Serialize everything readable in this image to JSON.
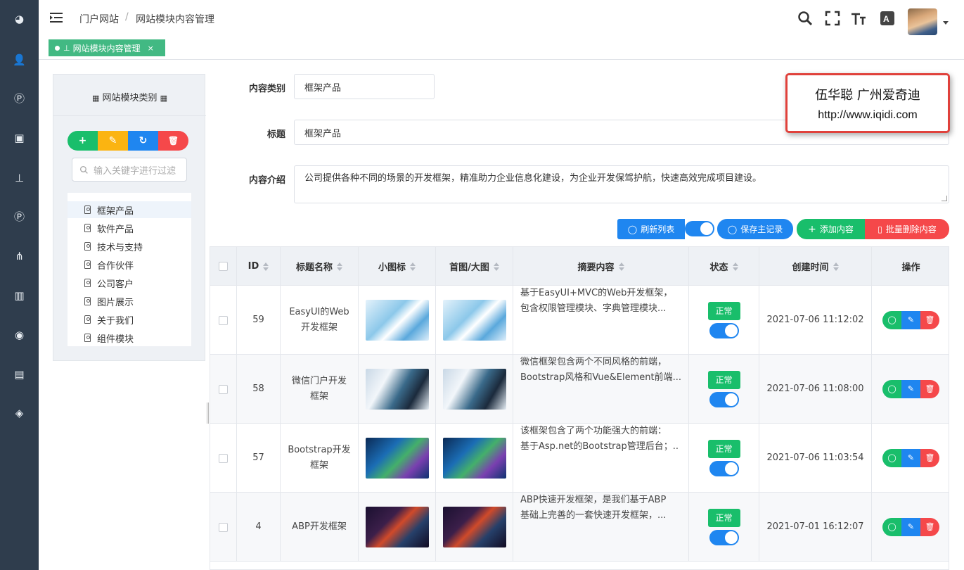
{
  "breadcrumb": {
    "root": "门户网站",
    "current": "网站模块内容管理"
  },
  "tab": {
    "label": "网站模块内容管理",
    "close": "×"
  },
  "tree": {
    "title": "网站模块类别",
    "search_placeholder": "输入关键字进行过滤",
    "items": [
      "框架产品",
      "软件产品",
      "技术与支持",
      "合作伙伴",
      "公司客户",
      "图片展示",
      "关于我们",
      "组件模块"
    ],
    "buttons": {
      "add": "+",
      "edit": "✎",
      "refresh": "↻",
      "delete": "🗑"
    }
  },
  "form": {
    "category_label": "内容类别",
    "category_value": "框架产品",
    "title_label": "标题",
    "title_value": "框架产品",
    "intro_label": "内容介绍",
    "intro_value": "公司提供各种不同的场景的开发框架，精准助力企业信息化建设，为企业开发保驾护航，快速高效完成项目建设。"
  },
  "watermark": {
    "line1": "伍华聪 广州爱奇迪",
    "line2": "http://www.iqidi.com"
  },
  "toolbar": {
    "refresh": "刷新列表",
    "save": "保存主记录",
    "add": "添加内容",
    "batch_delete": "批量删除内容"
  },
  "table": {
    "headers": {
      "id": "ID",
      "title": "标题名称",
      "icon": "小图标",
      "banner": "首图/大图",
      "summary": "摘要内容",
      "status": "状态",
      "created": "创建时间",
      "actions": "操作"
    },
    "rows": [
      {
        "id": "59",
        "title1": "EasyUI的Web",
        "title2": "开发框架",
        "sum1": "基于EasyUI+MVC的Web开发框架，",
        "sum2": "包含权限管理模块、字典管理模块...",
        "status": "正常",
        "created": "2021-07-06 11:12:02"
      },
      {
        "id": "58",
        "title1": "微信门户开发",
        "title2": "框架",
        "sum1": "微信框架包含两个不同风格的前端，",
        "sum2": "Bootstrap风格和Vue&Element前端...",
        "status": "正常",
        "created": "2021-07-06 11:08:00"
      },
      {
        "id": "57",
        "title1": "Bootstrap开发",
        "title2": "框架",
        "sum1": "该框架包含了两个功能强大的前端：",
        "sum2": "基于Asp.net的Bootstrap管理后台；..",
        "status": "正常",
        "created": "2021-07-06 11:03:54"
      },
      {
        "id": "4",
        "title1": "ABP开发框架",
        "title2": "",
        "sum1": "ABP快速开发框架，是我们基于ABP",
        "sum2": "基础上完善的一套快速开发框架，...",
        "status": "正常",
        "created": "2021-07-01 16:12:07"
      }
    ]
  },
  "colors": {
    "sidebar": "#2f3d4d",
    "green": "#19be6b",
    "blue": "#1f86f0",
    "red": "#f5484a",
    "yellow": "#fbb411"
  }
}
